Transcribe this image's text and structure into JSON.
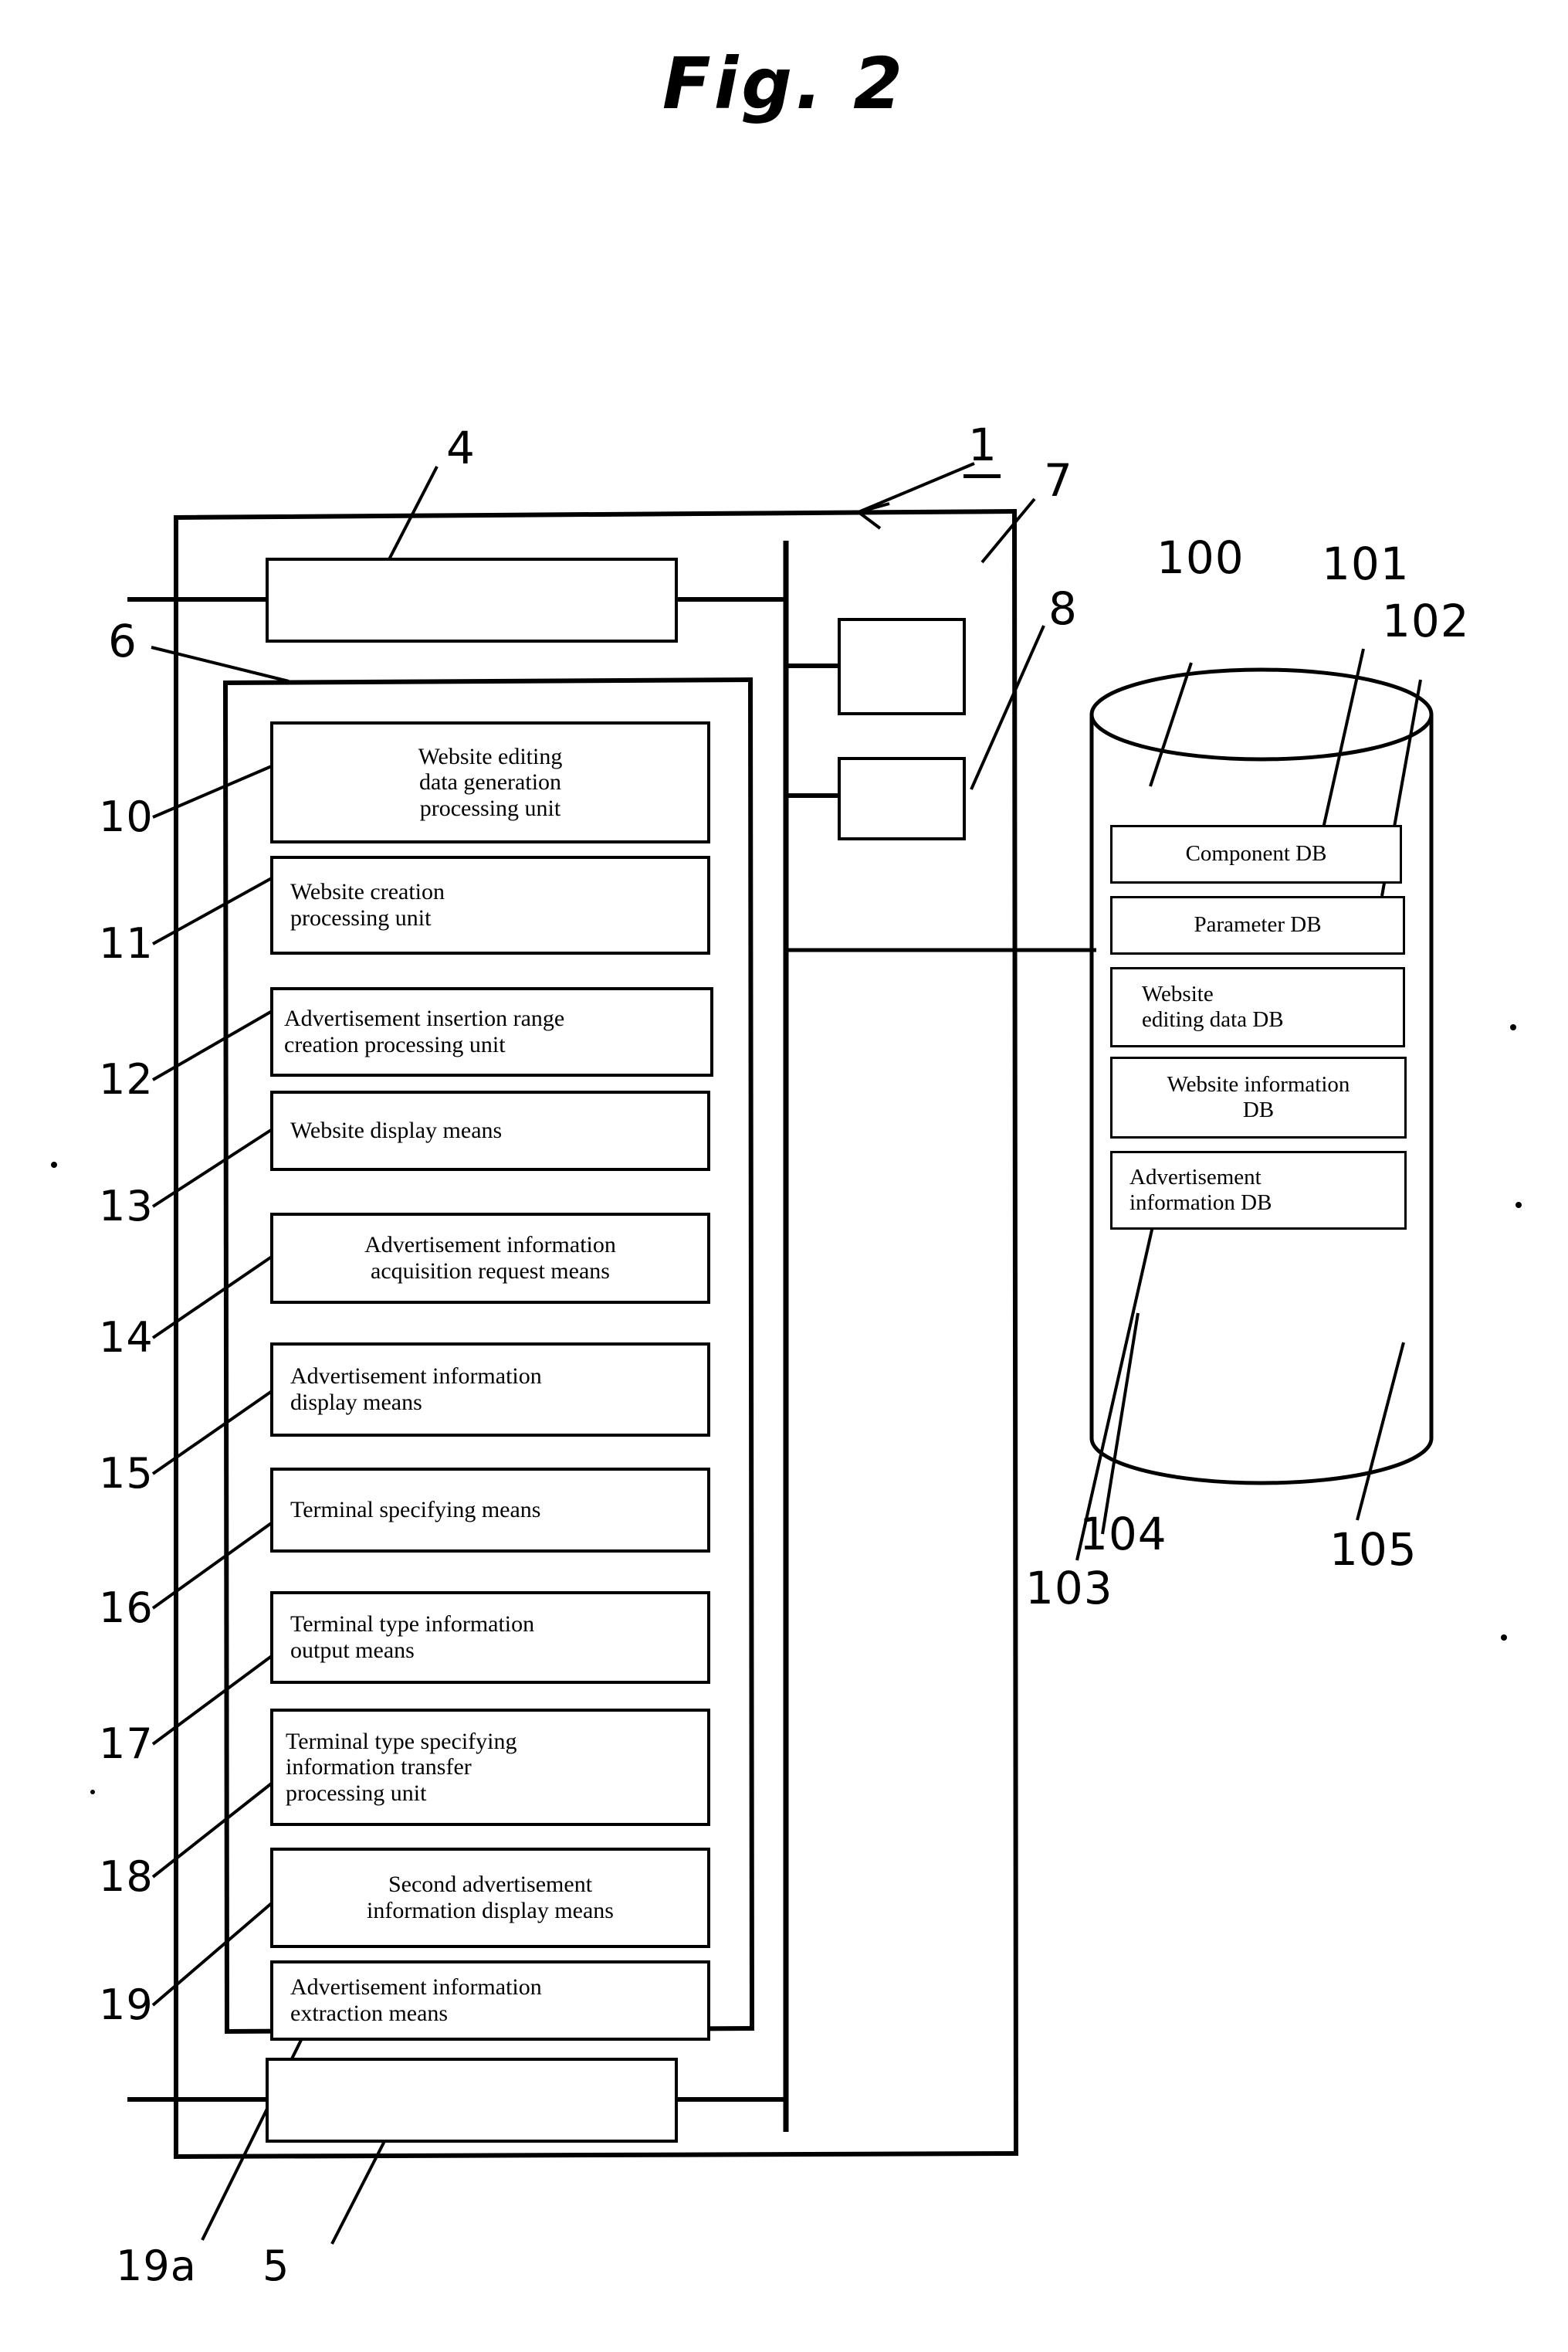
{
  "figure": {
    "title": "Fig. 2"
  },
  "system": {
    "label_1": "1",
    "label_4": "4",
    "label_5": "5",
    "label_6": "6",
    "label_7": "7",
    "label_8": "8",
    "label_19a": "19a"
  },
  "processing_units": [
    {
      "ref": "10",
      "label": "Website editing\ndata generation\nprocessing unit",
      "align": "center"
    },
    {
      "ref": "11",
      "label": "Website creation\nprocessing unit",
      "align": "left"
    },
    {
      "ref": "12",
      "label": "Advertisement insertion range\ncreation processing unit",
      "align": "left"
    },
    {
      "ref": "13",
      "label": "Website display means",
      "align": "left"
    },
    {
      "ref": "14",
      "label": "Advertisement information\nacquisition request means",
      "align": "left"
    },
    {
      "ref": "15",
      "label": "Advertisement information\ndisplay means",
      "align": "left"
    },
    {
      "ref": "16",
      "label": "Terminal specifying means",
      "align": "left"
    },
    {
      "ref": "17",
      "label": "Terminal type information\noutput means",
      "align": "left"
    },
    {
      "ref": "18",
      "label": "Terminal type specifying\ninformation transfer\nprocessing unit",
      "align": "left"
    },
    {
      "ref": "19",
      "label": "Second advertisement\ninformation display means",
      "align": "center"
    },
    {
      "ref": "19a",
      "label": "Advertisement information\nextraction means",
      "align": "left"
    }
  ],
  "databases": {
    "ref_cylinder": "100",
    "items": [
      {
        "ref": "101",
        "label": "Component DB",
        "align": "center"
      },
      {
        "ref": "102",
        "label": "Parameter DB",
        "align": "center"
      },
      {
        "ref": "103",
        "label": "Website\nediting data DB",
        "align": "left"
      },
      {
        "ref": "104",
        "label": "Website information\nDB",
        "align": "center"
      },
      {
        "ref": "105",
        "label": "Advertisement\ninformation DB",
        "align": "left"
      }
    ]
  },
  "colors": {
    "ink": "#000000",
    "paper": "#ffffff"
  }
}
